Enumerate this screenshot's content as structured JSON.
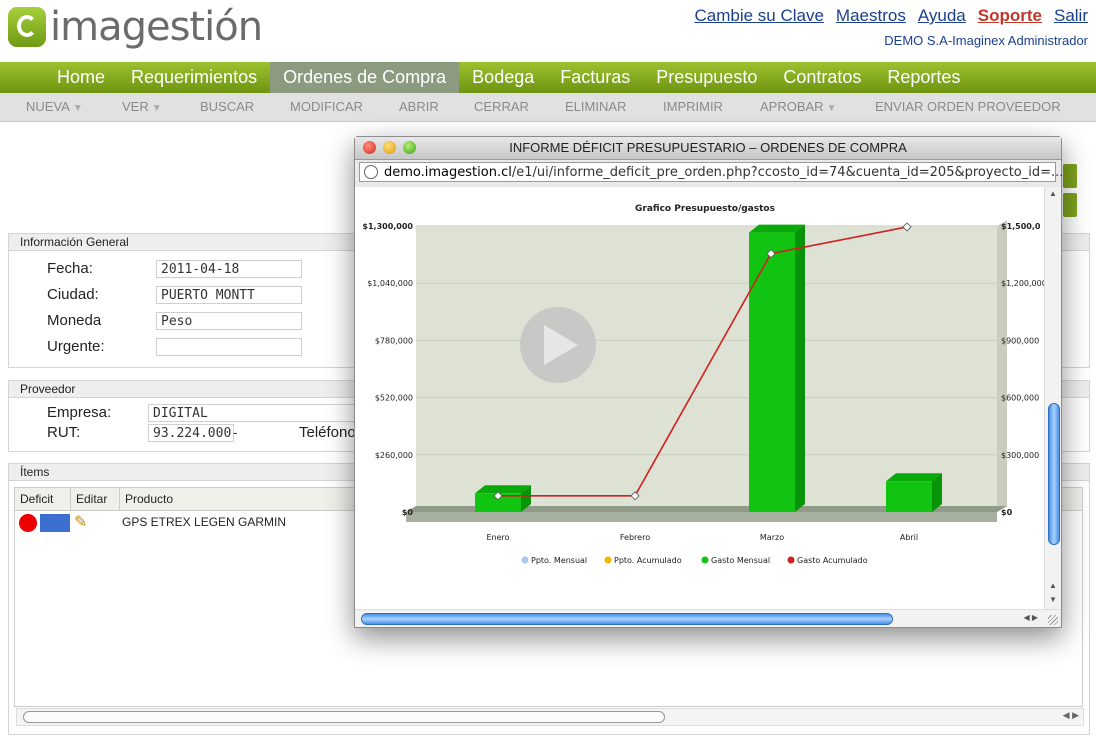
{
  "header": {
    "logo_text": "imagestión",
    "links": [
      "Cambie su Clave",
      "Maestros",
      "Ayuda",
      "Soporte",
      "Salir"
    ],
    "company": "DEMO S.A-Imaginex Administrador"
  },
  "nav": {
    "items": [
      "Home",
      "Requerimientos",
      "Ordenes de Compra",
      "Bodega",
      "Facturas",
      "Presupuesto",
      "Contratos",
      "Reportes"
    ],
    "active": "Ordenes de Compra"
  },
  "subnav": {
    "items": [
      "NUEVA",
      "VER",
      "BUSCAR",
      "MODIFICAR",
      "ABRIR",
      "CERRAR",
      "ELIMINAR",
      "IMPRIMIR",
      "APROBAR",
      "ENVIAR ORDEN PROVEEDOR"
    ]
  },
  "info_general": {
    "title": "Información General",
    "fecha_label": "Fecha:",
    "fecha": "2011-04-18",
    "ciudad_label": "Ciudad:",
    "ciudad": "PUERTO MONTT",
    "moneda_label": "Moneda",
    "moneda": "Peso",
    "urgente_label": "Urgente:",
    "urgente": ""
  },
  "proveedor": {
    "title": "Proveedor",
    "empresa_label": "Empresa:",
    "empresa": "DIGITAL",
    "rut_label": "RUT:",
    "rut": "93.224.000-",
    "telefono_label": "Teléfono"
  },
  "items": {
    "title": "Ítems",
    "columns": [
      "Deficit",
      "Editar",
      "Producto"
    ],
    "rows": [
      {
        "producto": "GPS ETREX LEGEN GARMIN"
      }
    ]
  },
  "popup": {
    "title": "INFORME DÉFICIT PRESUPUESTARIO – ORDENES DE COMPRA",
    "url_domain": "demo.imagestion.cl",
    "url_path": "/e1/ui/informe_deficit_pre_orden.php?ccosto_id=74&cuenta_id=205&proyecto_id=..."
  },
  "chart_data": {
    "type": "bar",
    "title": "Grafico Presupuesto/gastos",
    "categories": [
      "Enero",
      "Febrero",
      "Marzo",
      "Abril"
    ],
    "y_left": {
      "ticks": [
        "$0",
        "$260,000",
        "$520,000",
        "$780,000",
        "$1,040,000",
        "$1,300,000"
      ],
      "ylim": [
        0,
        1300000
      ]
    },
    "y_right": {
      "ticks": [
        "$0",
        "$300,000",
        "$600,000",
        "$900,000",
        "$1,200,000",
        "$1,500,0"
      ],
      "ylim": [
        0,
        1500000
      ]
    },
    "series": [
      {
        "name": "Ppto. Mensual",
        "color": "#a6c8ec",
        "values": [
          0,
          0,
          0,
          0
        ]
      },
      {
        "name": "Ppto. Acumulado",
        "color": "#f0b400",
        "values": [
          0,
          0,
          0,
          0
        ]
      },
      {
        "name": "Gasto Mensual",
        "color": "#12c412",
        "values": [
          85000,
          0,
          1270000,
          140000
        ],
        "axis": "left"
      },
      {
        "name": "Gasto Acumulado",
        "color": "#d02020",
        "values": [
          85000,
          85000,
          1355000,
          1495000
        ],
        "axis": "right"
      }
    ],
    "legend": "bottom",
    "grid": true
  }
}
